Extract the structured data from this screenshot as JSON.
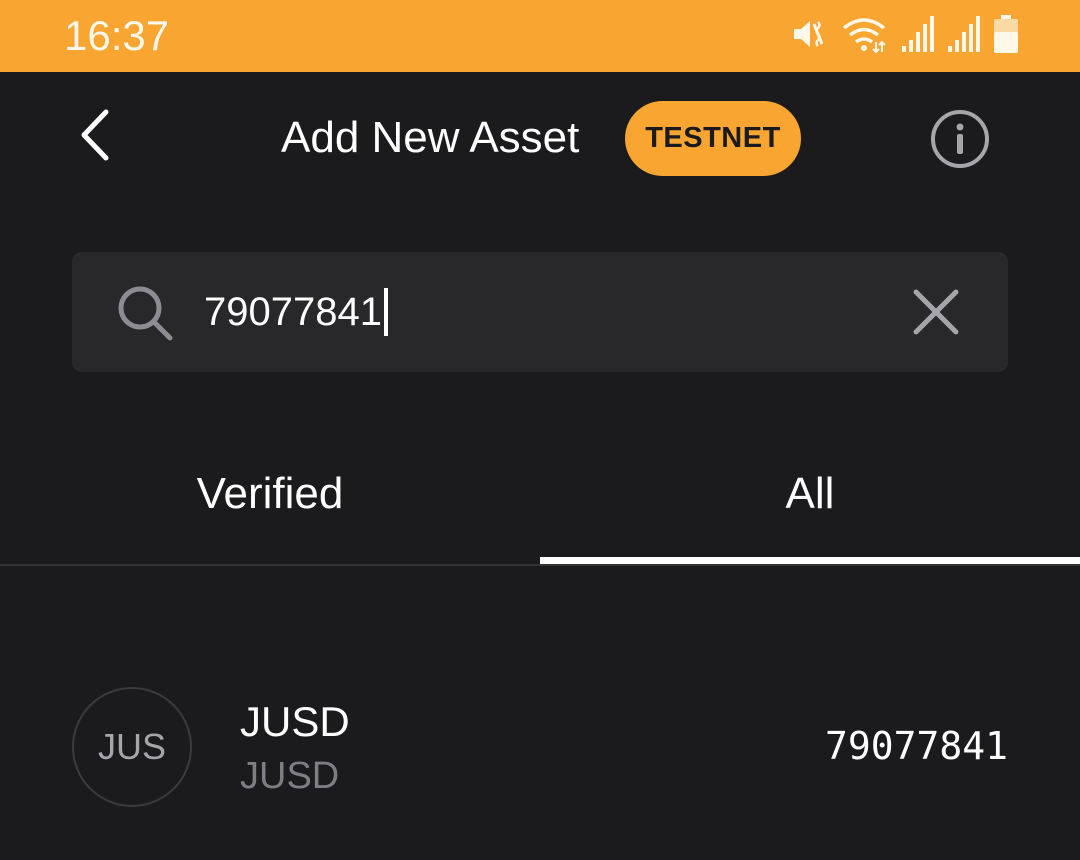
{
  "status_bar": {
    "time": "16:37",
    "icons": [
      "mute-vibrate-icon",
      "wifi-icon",
      "signal-1-icon",
      "signal-2-icon",
      "battery-icon"
    ]
  },
  "header": {
    "title": "Add New Asset",
    "network_badge": "TESTNET",
    "back_icon": "chevron-left-icon",
    "info_icon": "info-circle-icon"
  },
  "search": {
    "value": "79077841",
    "icon": "search-icon",
    "clear_icon": "close-icon"
  },
  "tabs": [
    {
      "label": "Verified",
      "active": false
    },
    {
      "label": "All",
      "active": true
    }
  ],
  "results": [
    {
      "avatar_text": "JUS",
      "name": "JUSD",
      "unit": "JUSD",
      "asset_id": "79077841"
    }
  ],
  "colors": {
    "accent": "#f8a631",
    "background": "#1b1b1d",
    "search_bg": "#28282b",
    "muted_text": "#7d7d83"
  }
}
